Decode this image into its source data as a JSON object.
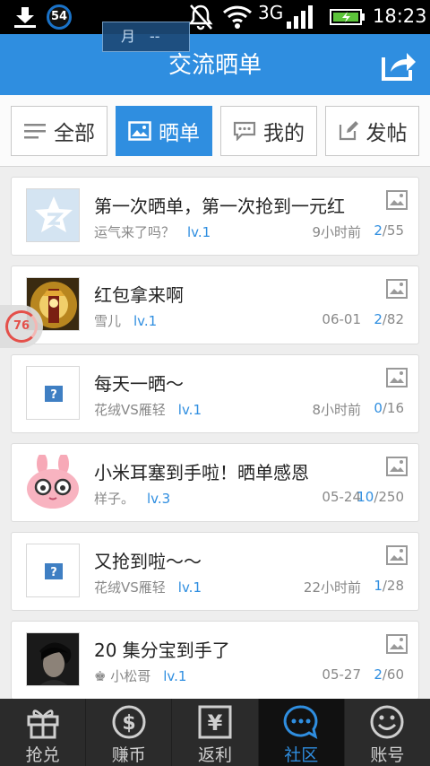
{
  "statusbar": {
    "badge": "54",
    "network": "3G",
    "time": "18:23"
  },
  "month_tip": {
    "label": "月",
    "value": "--"
  },
  "header": {
    "title": "交流晒单"
  },
  "tabs": [
    {
      "label": "全部",
      "icon": "list-icon"
    },
    {
      "label": "晒单",
      "icon": "photo-icon"
    },
    {
      "label": "我的",
      "icon": "chat-icon"
    },
    {
      "label": "发帖",
      "icon": "edit-icon"
    }
  ],
  "posts": [
    {
      "title": "第一次晒单，第一次抢到一元红",
      "author": "运气来了吗？",
      "level": "lv.1",
      "time": "9小时前",
      "count_a": "2",
      "count_b": "/55",
      "avatar": "star-logo"
    },
    {
      "title": "红包拿来啊",
      "author": "雪儿",
      "level": "lv.1",
      "time": "06-01",
      "count_a": "2",
      "count_b": "/82",
      "avatar": "temple-photo"
    },
    {
      "title": "每天一晒～",
      "author": "花绒VS雁轻",
      "level": "lv.1",
      "time": "8小时前",
      "count_a": "0",
      "count_b": "/16",
      "avatar": "placeholder"
    },
    {
      "title": "小米耳塞到手啦！晒单感恩",
      "author": "样子。",
      "level": "lv.3",
      "time": "05-24",
      "count_a": "10",
      "count_b": "/250",
      "avatar": "pink-bunny"
    },
    {
      "title": "又抢到啦～～",
      "author": "花绒VS雁轻",
      "level": "lv.1",
      "time": "22小时前",
      "count_a": "1",
      "count_b": "/28",
      "avatar": "placeholder"
    },
    {
      "title": "20 集分宝到手了",
      "author": "♚ 小松哥",
      "level": "lv.1",
      "time": "05-27",
      "count_a": "2",
      "count_b": "/60",
      "avatar": "portrait-photo"
    }
  ],
  "float_bubble": {
    "value": "76"
  },
  "bottom_nav": [
    {
      "label": "抢兑",
      "icon": "gift-icon"
    },
    {
      "label": "赚币",
      "icon": "dollar-icon"
    },
    {
      "label": "返利",
      "icon": "yen-icon"
    },
    {
      "label": "社区",
      "icon": "chat-bubble-icon"
    },
    {
      "label": "账号",
      "icon": "smiley-icon"
    }
  ],
  "colors": {
    "accent": "#2f8ee0",
    "header": "#2f8ee0",
    "nav_bg": "#2b2b2b"
  }
}
